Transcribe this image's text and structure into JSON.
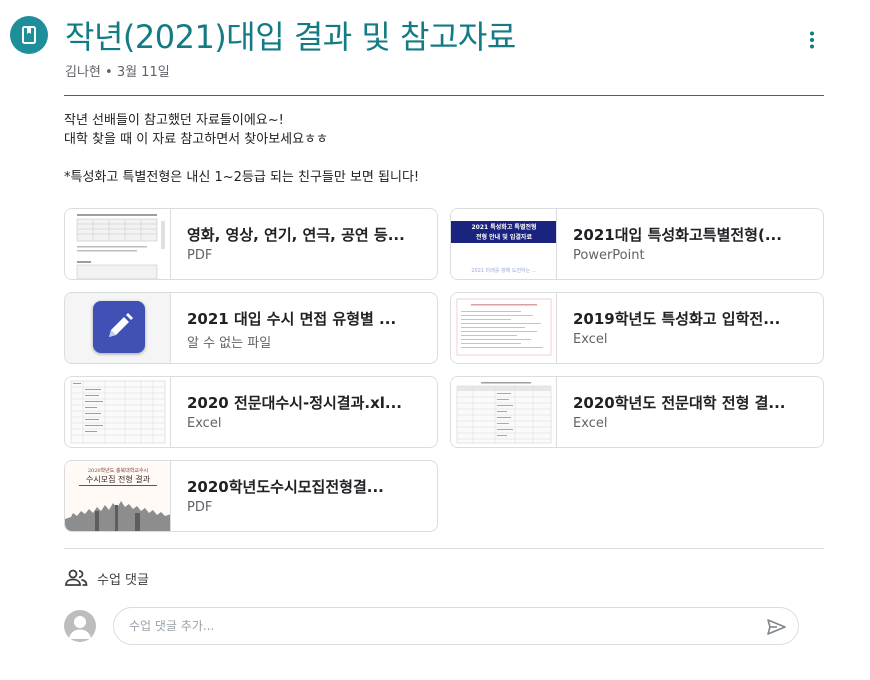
{
  "post": {
    "title": "작년(2021)대입 결과 및 참고자료",
    "meta": "김나현 • 3월 11일",
    "body_lines": [
      "작년 선배들이 참고했던 자료들이에요~!",
      "대학 찾을 때 이 자료 참고하면서 찾아보세요ㅎㅎ",
      "",
      "*특성화고 특별전형은 내신 1~2등급 되는 친구들만 보면 됩니다!"
    ]
  },
  "attachments": [
    {
      "title": "영화, 영상, 연기, 연극, 공연 등...",
      "type": "PDF",
      "thumb": "document-thumbnail"
    },
    {
      "title": "2021대입 특성화고특별전형(...",
      "type": "PowerPoint",
      "thumb": "slide-thumbnail",
      "thumb_text": {
        "line1": "2021 특성화고 특별전형",
        "line2": "전형 안내 및 입결자료",
        "footer": "2021 미래를 향해 도전하는 ..."
      }
    },
    {
      "title": "2021 대입 수시 면접 유형별 ...",
      "type": "알 수 없는 파일",
      "thumb": "pencil-app-icon"
    },
    {
      "title": "2019학년도 특성화고 입학전...",
      "type": "Excel",
      "thumb": "spreadsheet-thumbnail"
    },
    {
      "title": "2020 전문대수시-정시결과.xl...",
      "type": "Excel",
      "thumb": "spreadsheet-thumbnail"
    },
    {
      "title": "2020학년도 전문대학 전형 결...",
      "type": "Excel",
      "thumb": "spreadsheet-thumbnail"
    },
    {
      "title": "2020학년도수시모집전형결...",
      "type": "PDF",
      "thumb": "cover-thumbnail",
      "thumb_text": {
        "line1": "2020학년도 충북대학교수시",
        "line2": "수시모집 전형 결과"
      }
    }
  ],
  "comments": {
    "label": "수업 댓글",
    "placeholder": "수업 댓글 추가..."
  },
  "colors": {
    "accent": "#137b83",
    "icon_bg": "#1e8e9a",
    "border": "#dadce0",
    "slide_header": "#1a237e"
  },
  "icons": [
    "assignment-bookmark-icon",
    "more-vert-icon",
    "people-icon",
    "avatar-icon",
    "send-icon"
  ]
}
